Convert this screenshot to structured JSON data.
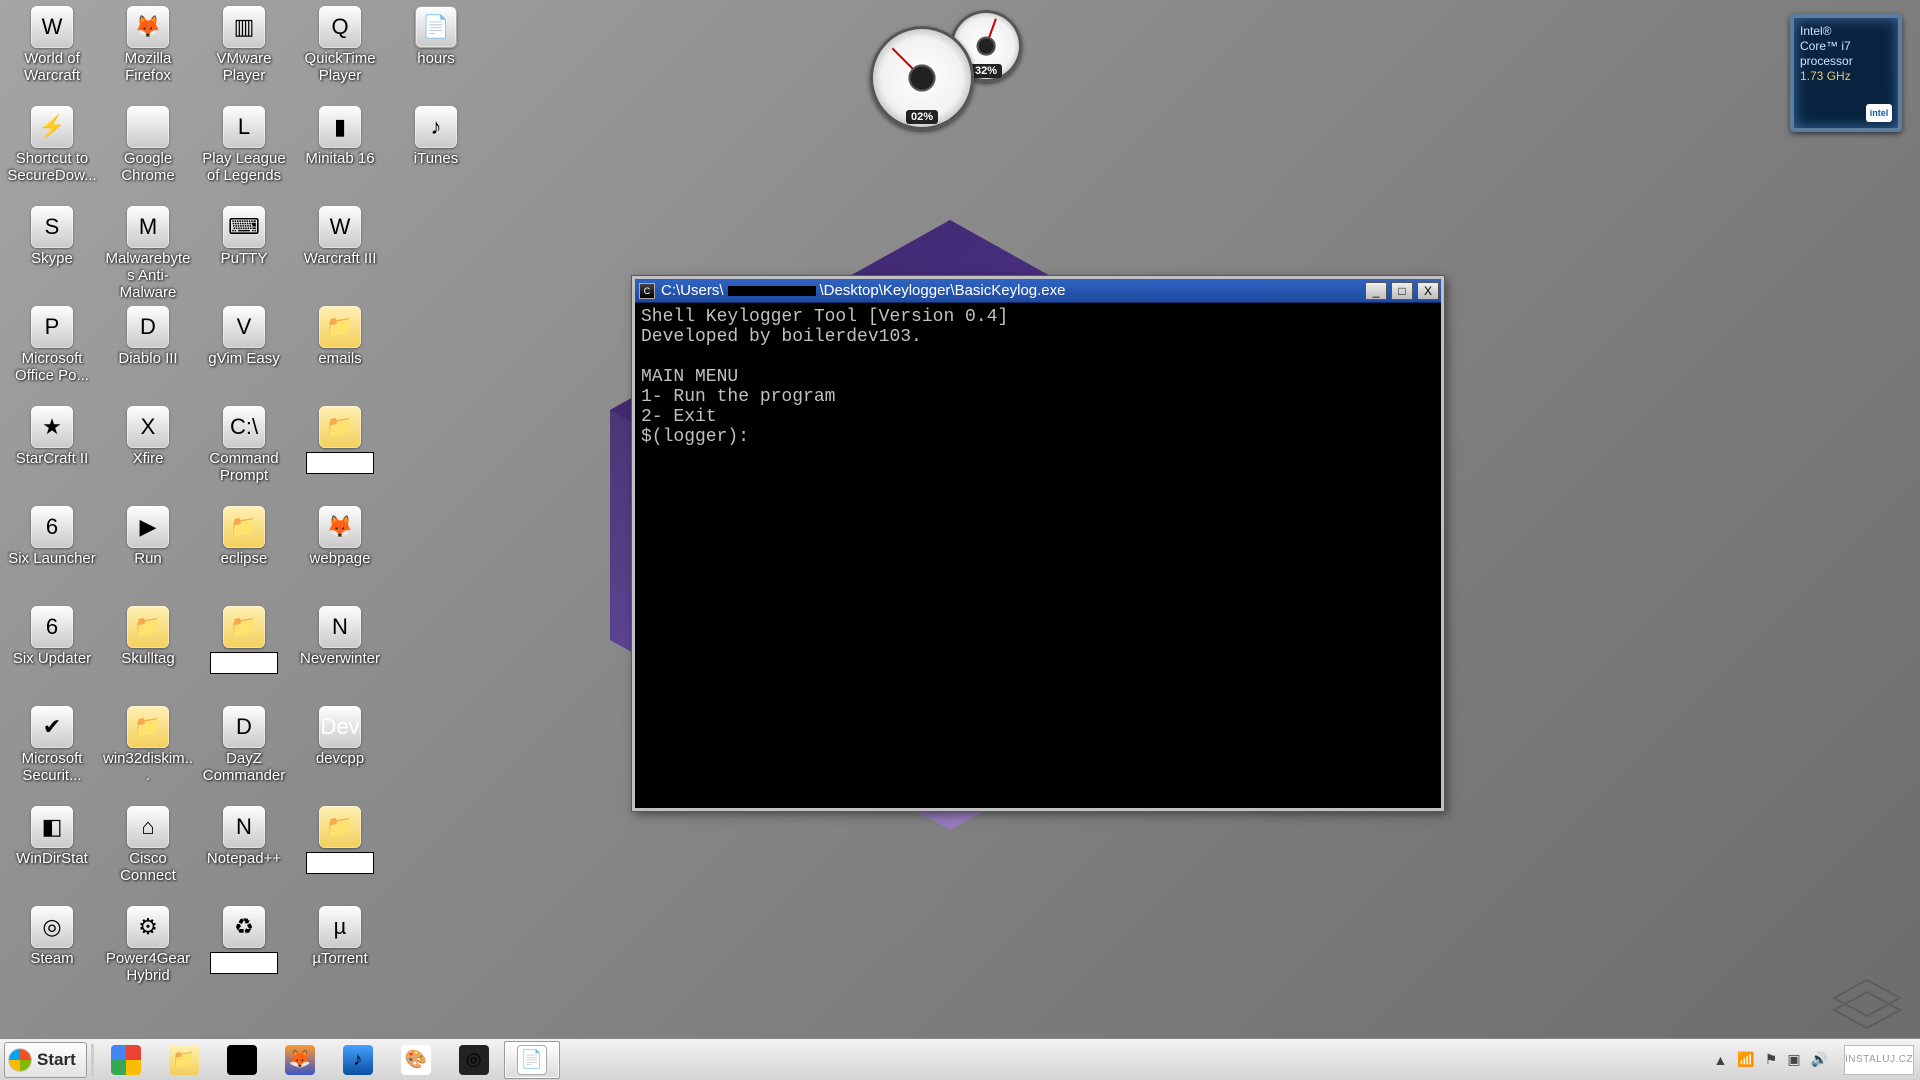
{
  "desktop_icons": [
    {
      "label": "World of Warcraft",
      "cls": "bg-wow",
      "glyph": "W"
    },
    {
      "label": "Mozilla Firefox",
      "cls": "bg-ff",
      "glyph": "🦊"
    },
    {
      "label": "VMware Player",
      "cls": "bg-vm",
      "glyph": "▥"
    },
    {
      "label": "QuickTime Player",
      "cls": "bg-qt",
      "glyph": "Q"
    },
    {
      "label": "hours",
      "cls": "bg-txt",
      "glyph": "📄"
    },
    {
      "label": "Shortcut to SecureDow...",
      "cls": "bg-secdl",
      "glyph": "⚡"
    },
    {
      "label": "Google Chrome",
      "cls": "bg-chico",
      "glyph": ""
    },
    {
      "label": "Play League of Legends",
      "cls": "bg-lol",
      "glyph": "L"
    },
    {
      "label": "Minitab 16",
      "cls": "bg-mt",
      "glyph": "▮"
    },
    {
      "label": "iTunes",
      "cls": "bg-it",
      "glyph": "♪"
    },
    {
      "label": "Skype",
      "cls": "bg-sk",
      "glyph": "S"
    },
    {
      "label": "Malwarebytes Anti-Malware",
      "cls": "bg-mb",
      "glyph": "M"
    },
    {
      "label": "PuTTY",
      "cls": "bg-pt",
      "glyph": "⌨"
    },
    {
      "label": "Warcraft III",
      "cls": "bg-w3",
      "glyph": "W"
    },
    {
      "label": "",
      "cls": "",
      "glyph": "",
      "empty": true
    },
    {
      "label": "Microsoft Office Po...",
      "cls": "bg-ppt",
      "glyph": "P"
    },
    {
      "label": "Diablo III",
      "cls": "bg-d3",
      "glyph": "D"
    },
    {
      "label": "gVim Easy",
      "cls": "bg-gv",
      "glyph": "V"
    },
    {
      "label": "emails",
      "cls": "folder",
      "glyph": "📁"
    },
    {
      "label": "",
      "cls": "",
      "glyph": "",
      "empty": true
    },
    {
      "label": "StarCraft II",
      "cls": "bg-sc2",
      "glyph": "★"
    },
    {
      "label": "Xfire",
      "cls": "bg-xf",
      "glyph": "X"
    },
    {
      "label": "Command Prompt",
      "cls": "bg-cmd",
      "glyph": "C:\\"
    },
    {
      "label": "",
      "cls": "folder",
      "glyph": "📁",
      "blank_label": true
    },
    {
      "label": "",
      "cls": "",
      "glyph": "",
      "empty": true
    },
    {
      "label": "Six Launcher",
      "cls": "bg-six",
      "glyph": "6"
    },
    {
      "label": "Run",
      "cls": "bg-run",
      "glyph": "▶"
    },
    {
      "label": "eclipse",
      "cls": "folder",
      "glyph": "📁"
    },
    {
      "label": "webpage",
      "cls": "bg-ff",
      "glyph": "🦊"
    },
    {
      "label": "",
      "cls": "",
      "glyph": "",
      "empty": true
    },
    {
      "label": "Six Updater",
      "cls": "bg-six",
      "glyph": "6"
    },
    {
      "label": "Skulltag",
      "cls": "folder",
      "glyph": "📁"
    },
    {
      "label": "",
      "cls": "folder",
      "glyph": "📁",
      "blank_label": true
    },
    {
      "label": "Neverwinter",
      "cls": "bg-nw",
      "glyph": "N"
    },
    {
      "label": "",
      "cls": "",
      "glyph": "",
      "empty": true
    },
    {
      "label": "Microsoft Securit...",
      "cls": "bg-mse",
      "glyph": "✔"
    },
    {
      "label": "win32diskim...",
      "cls": "folder",
      "glyph": "📁"
    },
    {
      "label": "DayZ Commander",
      "cls": "bg-dz",
      "glyph": "D"
    },
    {
      "label": "devcpp",
      "cls": "bg-dev",
      "glyph": "Dev"
    },
    {
      "label": "",
      "cls": "",
      "glyph": "",
      "empty": true
    },
    {
      "label": "WinDirStat",
      "cls": "bg-wds",
      "glyph": "◧"
    },
    {
      "label": "Cisco Connect",
      "cls": "bg-cc",
      "glyph": "⌂"
    },
    {
      "label": "Notepad++",
      "cls": "bg-np",
      "glyph": "N"
    },
    {
      "label": "",
      "cls": "folder",
      "glyph": "📁",
      "blank_label": true
    },
    {
      "label": "",
      "cls": "",
      "glyph": "",
      "empty": true
    },
    {
      "label": "Steam",
      "cls": "bg-st",
      "glyph": "◎"
    },
    {
      "label": "Power4Gear Hybrid",
      "cls": "bg-p4g",
      "glyph": "⚙"
    },
    {
      "label": "",
      "cls": "bg-rc",
      "glyph": "♻",
      "blank_label": true
    },
    {
      "label": "µTorrent",
      "cls": "bg-ut",
      "glyph": "µ"
    },
    {
      "label": "",
      "cls": "",
      "glyph": "",
      "empty": true
    }
  ],
  "cpu_gadget": {
    "big_readout": "02%",
    "small_readout": "32%"
  },
  "intel_gadget": {
    "line1": "Intel®",
    "line2": "Core™ i7",
    "line3": "processor",
    "line4": "1.73 GHz",
    "logo_text": "intel"
  },
  "console": {
    "title_prefix": "C:\\Users\\",
    "title_suffix": "\\Desktop\\Keylogger\\BasicKeylog.exe",
    "lines": [
      "Shell Keylogger Tool [Version 0.4]",
      "Developed by boilerdev103.",
      "",
      "MAIN MENU",
      "1- Run the program",
      "2- Exit",
      "$(logger):"
    ],
    "btn_min": "_",
    "btn_max": "□",
    "btn_close": "X"
  },
  "taskbar": {
    "start_label": "Start",
    "items": [
      {
        "name": "chrome",
        "cls": "bg-chico",
        "glyph": "",
        "active": false
      },
      {
        "name": "explorer",
        "cls": "bg-expl",
        "glyph": "📁",
        "active": false
      },
      {
        "name": "cmd",
        "cls": "bg-cmd",
        "glyph": "C:\\",
        "active": false
      },
      {
        "name": "firefox",
        "cls": "bg-ff",
        "glyph": "🦊",
        "active": false
      },
      {
        "name": "itunes",
        "cls": "bg-it",
        "glyph": "♪",
        "active": false
      },
      {
        "name": "paint",
        "cls": "bg-paint",
        "glyph": "🎨",
        "active": false
      },
      {
        "name": "steam",
        "cls": "bg-st",
        "glyph": "◎",
        "active": false
      },
      {
        "name": "notepad",
        "cls": "bg-txt",
        "glyph": "📄",
        "active": true
      }
    ],
    "tray": {
      "chevron": "▲",
      "wifi": "📶",
      "flag": "⚑",
      "action": "▣",
      "volume": "🔊",
      "brand": "INSTALUJ.CZ"
    }
  }
}
